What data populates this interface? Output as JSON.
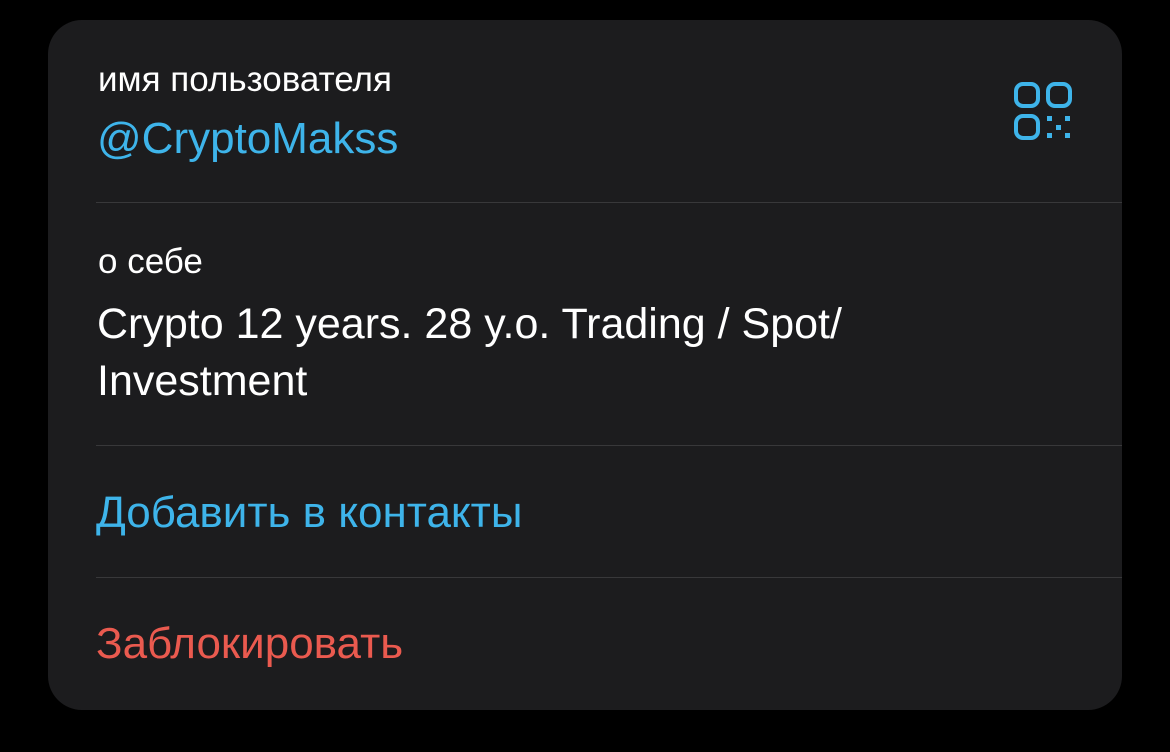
{
  "username_row": {
    "label": "имя пользователя",
    "value": "@CryptoMakss",
    "qr_icon": "qr-code-icon"
  },
  "bio_row": {
    "label": "о себе",
    "value": "Crypto 12 years. 28 y.o. Trading / Spot/ Investment"
  },
  "actions": {
    "add_contact": "Добавить в контакты",
    "block": "Заблокировать"
  },
  "colors": {
    "background": "#000000",
    "card": "#1c1c1e",
    "accent": "#3eb4ea",
    "destructive": "#ea5a4f",
    "divider": "#38383a"
  }
}
